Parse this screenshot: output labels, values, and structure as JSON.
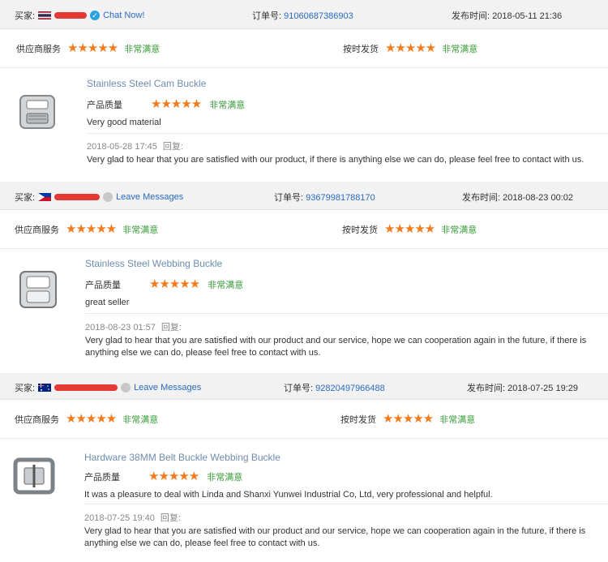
{
  "labels": {
    "buyer": "买家:",
    "order": "订单号:",
    "date": "发布时间:",
    "supplier_service": "供应商服务",
    "on_time": "按时发货",
    "quality": "产品质量",
    "rating_text": "非常满意",
    "reply": "回复:",
    "stars": "★★★★★"
  },
  "reviews": [
    {
      "contact": "Chat Now!",
      "order_no": "91060687386903",
      "date": "2018-05-11 21:36",
      "product": "Stainless Steel Cam Buckle",
      "comment": "Very good material",
      "reply_date": "2018-05-28 17:45",
      "reply_text": "Very glad to hear that you are satisfied with our product, if there is anything else we can do, please feel free to contact with us."
    },
    {
      "contact": "Leave Messages",
      "order_no": "93679981788170",
      "date": "2018-08-23 00:02",
      "product": "Stainless Steel Webbing Buckle",
      "comment": "great seller",
      "reply_date": "2018-08-23 01:57",
      "reply_text": "Very glad to hear that you are satisfied with our product and our service, hope we can cooperation again in the future, if there is anything else we can do, please feel free to contact with us."
    },
    {
      "contact": "Leave Messages",
      "order_no": "92820497966488",
      "date": "2018-07-25 19:29",
      "product": "Hardware 38MM Belt Buckle Webbing Buckle",
      "comment": "It was a pleasure to deal with Linda and Shanxi Yunwei Industrial Co, Ltd, very professional and helpful.",
      "reply_date": "2018-07-25 19:40",
      "reply_text": "Very glad to hear that you are satisfied with our product and our service, hope we can cooperation again in the future, if there is anything else we can do, please feel free to contact with us."
    }
  ]
}
